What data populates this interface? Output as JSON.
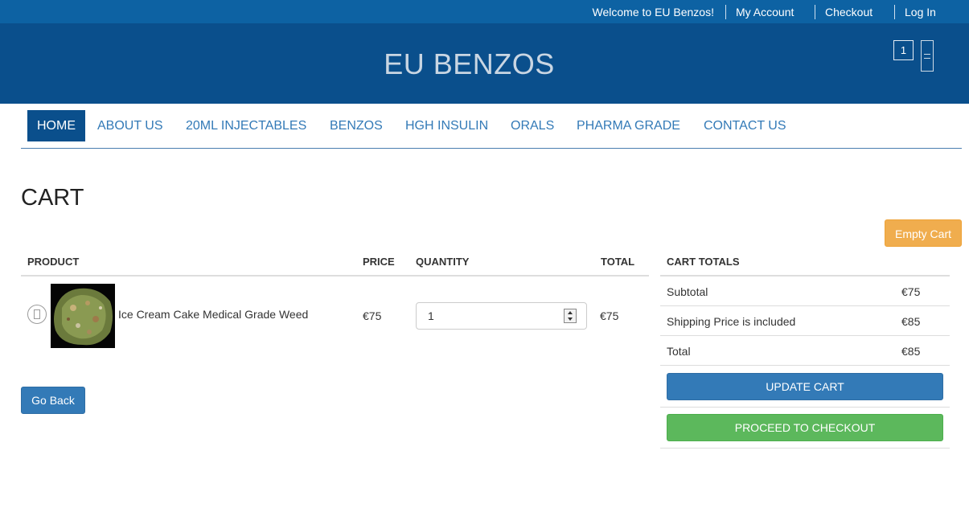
{
  "topbar": {
    "welcome": "Welcome to EU Benzos!",
    "my_account": "My Account",
    "checkout": "Checkout",
    "login": "Log In"
  },
  "header": {
    "site_title": "EU BENZOS",
    "cart_count": "1"
  },
  "nav": {
    "items": [
      "HOME",
      "ABOUT US",
      "20ML INJECTABLES",
      "BENZOS",
      "HGH INSULIN",
      "ORALS",
      "PHARMA GRADE",
      "CONTACT US"
    ],
    "active": "HOME"
  },
  "cart": {
    "title": "CART",
    "empty_label": "Empty Cart",
    "columns": [
      "PRODUCT",
      "PRICE",
      "QUANTITY",
      "TOTAL"
    ],
    "items": [
      {
        "name": "Ice Cream Cake Medical Grade Weed",
        "price": "€75",
        "quantity": "1",
        "total": "€75"
      }
    ],
    "go_back_label": "Go Back"
  },
  "totals": {
    "heading": "CART TOTALS",
    "rows": [
      {
        "label": "Subtotal",
        "value": "€75"
      },
      {
        "label": "Shipping Price is included",
        "value": "€85"
      },
      {
        "label": "Total",
        "value": "€85"
      }
    ],
    "update_label": "UPDATE CART",
    "checkout_label": "PROCEED TO CHECKOUT"
  },
  "colors": {
    "topbar": "#0d62a3",
    "header": "#0a4f8c",
    "link": "#337ab7",
    "warning": "#f0ad4e",
    "success": "#5cb85c"
  }
}
